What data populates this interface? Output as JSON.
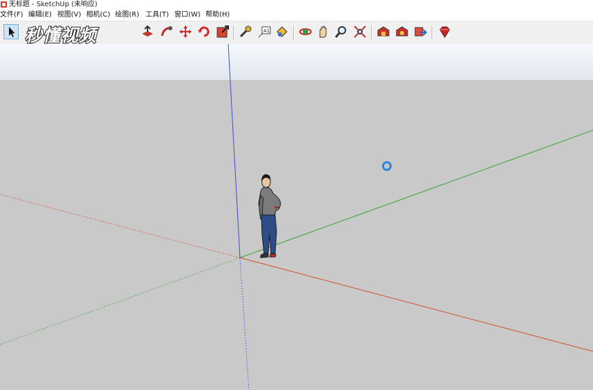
{
  "window": {
    "title": "无标题 - SketchUp (未响应)"
  },
  "menu": [
    {
      "label": "文件(F)"
    },
    {
      "label": "编辑(E)"
    },
    {
      "label": "视图(V)"
    },
    {
      "label": "相机(C)"
    },
    {
      "label": "绘图(R)"
    },
    {
      "label": "工具(T)"
    },
    {
      "label": "窗口(W)"
    },
    {
      "label": "帮助(H)"
    }
  ],
  "watermark": {
    "text": "秒懂视频"
  },
  "toolbar": {
    "icons": [
      "select-arrow-icon",
      "push-pull-icon",
      "follow-me-icon",
      "move-icon",
      "rotate-icon",
      "scale-icon",
      "tape-measure-icon",
      "text-icon",
      "paint-bucket-icon",
      "orbit-icon",
      "pan-icon",
      "zoom-icon",
      "zoom-extents-icon",
      "warehouse-icon",
      "extension-warehouse-icon",
      "share-model-icon",
      "ruby-icon"
    ]
  },
  "colors": {
    "red_axis": "#d24a2a",
    "green_axis": "#3aa33a",
    "blue_axis": "#3b4bd0",
    "cursor_ring": "#2f86d8",
    "sky_top": "#f6f9fc",
    "ground": "#c9c9c9"
  }
}
